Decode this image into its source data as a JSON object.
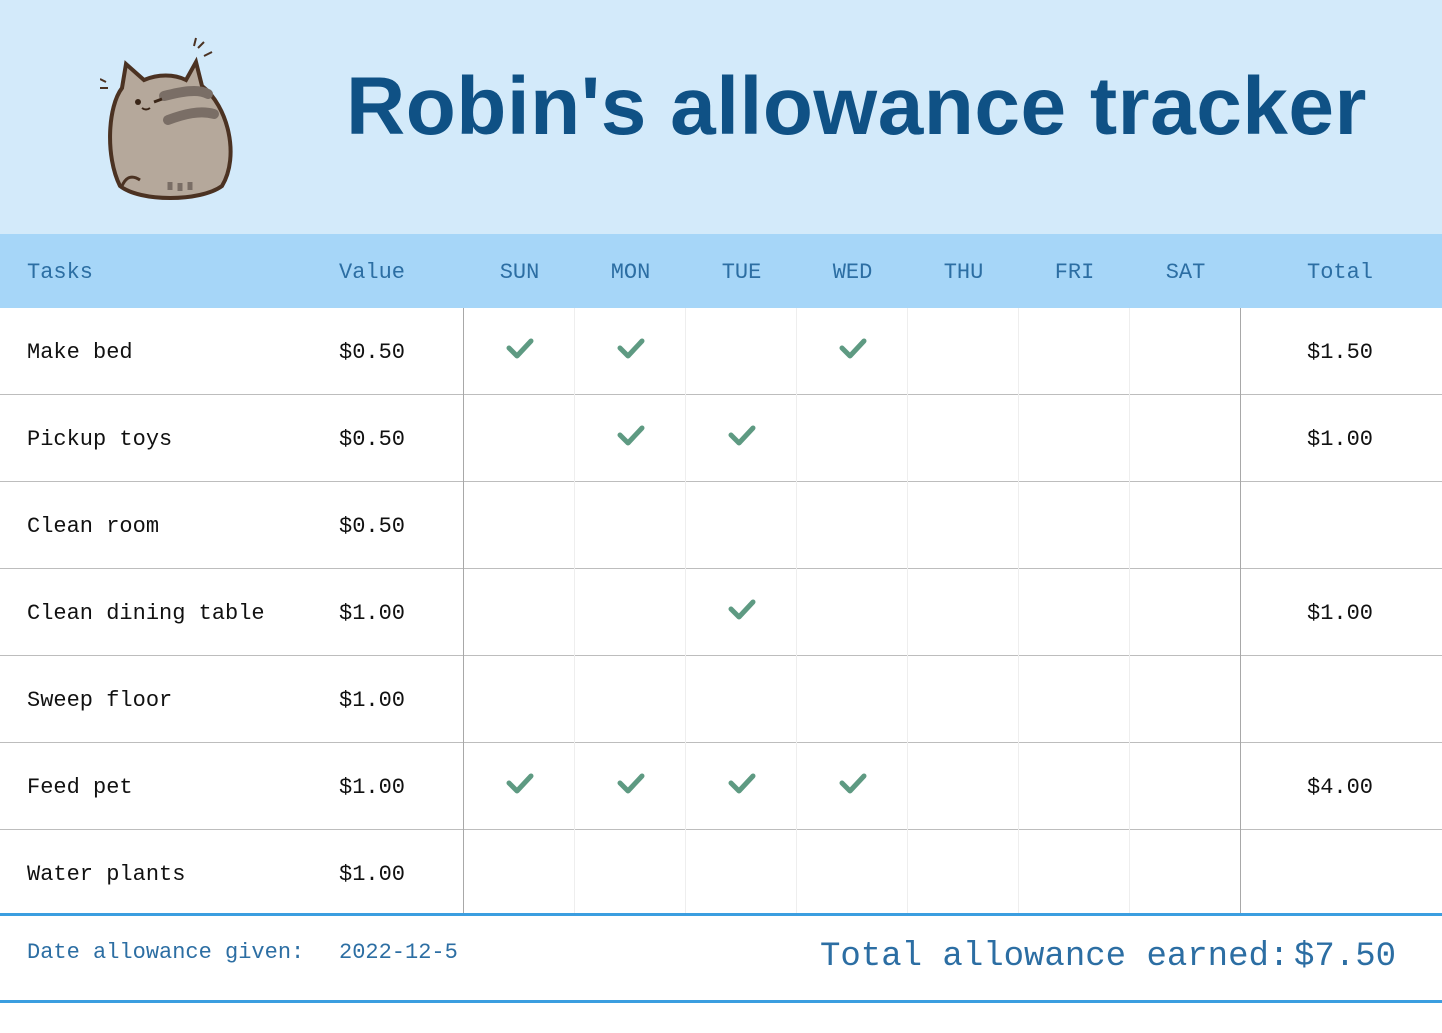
{
  "header": {
    "title": "Robin's allowance tracker",
    "logo_icon": "pusheen-cat-icon"
  },
  "columns": {
    "tasks": "Tasks",
    "value": "Value",
    "days": [
      "SUN",
      "MON",
      "TUE",
      "WED",
      "THU",
      "FRI",
      "SAT"
    ],
    "total": "Total"
  },
  "rows": [
    {
      "task": "Make bed",
      "value": "$0.50",
      "checks": [
        true,
        true,
        false,
        true,
        false,
        false,
        false
      ],
      "total": "$1.50"
    },
    {
      "task": "Pickup toys",
      "value": "$0.50",
      "checks": [
        false,
        true,
        true,
        false,
        false,
        false,
        false
      ],
      "total": "$1.00"
    },
    {
      "task": "Clean room",
      "value": "$0.50",
      "checks": [
        false,
        false,
        false,
        false,
        false,
        false,
        false
      ],
      "total": ""
    },
    {
      "task": "Clean dining table",
      "value": "$1.00",
      "checks": [
        false,
        false,
        true,
        false,
        false,
        false,
        false
      ],
      "total": "$1.00"
    },
    {
      "task": "Sweep floor",
      "value": "$1.00",
      "checks": [
        false,
        false,
        false,
        false,
        false,
        false,
        false
      ],
      "total": ""
    },
    {
      "task": "Feed pet",
      "value": "$1.00",
      "checks": [
        true,
        true,
        true,
        true,
        false,
        false,
        false
      ],
      "total": "$4.00"
    },
    {
      "task": "Water plants",
      "value": "$1.00",
      "checks": [
        false,
        false,
        false,
        false,
        false,
        false,
        false
      ],
      "total": ""
    }
  ],
  "footer": {
    "date_label": "Date allowance given:",
    "date_value": "2022-12-5",
    "total_label": "Total allowance earned:",
    "total_value": "$7.50"
  },
  "colors": {
    "title": "#0f5185",
    "banner": "#d3eafa",
    "header_row": "#a6d6f8",
    "check": "#5e9a82",
    "accent_line": "#3b9ee0"
  }
}
